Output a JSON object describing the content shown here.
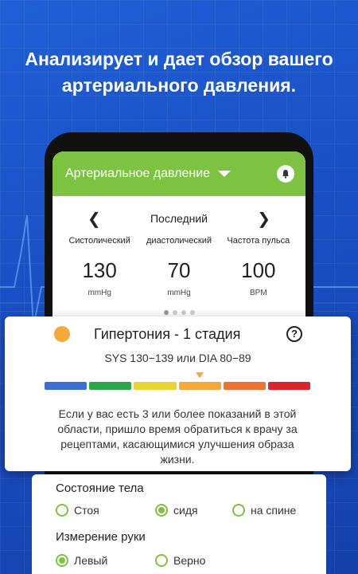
{
  "headline": {
    "line1": "Анализирует и дает обзор вашего",
    "line2": "артериального давления."
  },
  "app_bar": {
    "title": "Артериальное давление",
    "dropdown_icon": "caret-down-icon",
    "notification_icon": "bell-icon"
  },
  "period": {
    "prev_icon": "chevron-left-icon",
    "label": "Последний",
    "next_icon": "chevron-right-icon"
  },
  "metrics": [
    {
      "label": "Систолический",
      "value": "130",
      "unit": "mmHg"
    },
    {
      "label": "диастолический",
      "value": "70",
      "unit": "mmHg"
    },
    {
      "label": "Частота пульса",
      "value": "100",
      "unit": "BPM"
    }
  ],
  "pager": {
    "count": 4,
    "active": 0
  },
  "stage": {
    "title": "Гипертония - 1 стадия",
    "range": "SYS 130−139 или DIA 80−89",
    "color": "#f5a93a",
    "scale_colors": [
      "#3b6fd4",
      "#2aa84a",
      "#e8d534",
      "#f5a93a",
      "#ec7433",
      "#d9262a"
    ],
    "active_segment": 3,
    "text": "Если у вас есть 3 или более показаний в этой области, пришло время обратиться к врачу за рецептами, касающимися улучшения образа жизни."
  },
  "body_state": {
    "title": "Состояние тела",
    "options": [
      {
        "label": "Стоя",
        "selected": false
      },
      {
        "label": "сидя",
        "selected": true
      },
      {
        "label": "на спине",
        "selected": false
      }
    ]
  },
  "arm": {
    "title": "Измерение руки",
    "options": [
      {
        "label": "Левый",
        "selected": true
      },
      {
        "label": "Верно",
        "selected": false
      }
    ]
  },
  "colors": {
    "accent": "#7dc241",
    "background": "#1a4fc4"
  }
}
